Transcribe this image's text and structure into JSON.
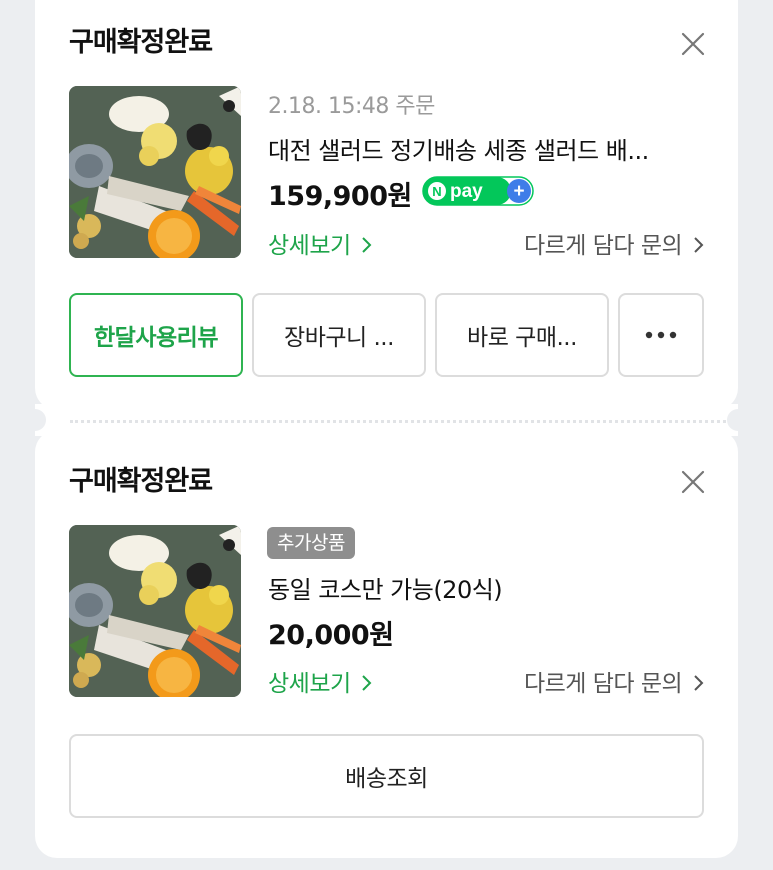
{
  "orders": [
    {
      "status": "구매확정완료",
      "date": "2.18. 15:48 주문",
      "product_name": "대전 샐러드 정기배송 세종 샐러드 배...",
      "price": "159,900원",
      "detail_link": "상세보기",
      "inquiry_link": "다르게 담다 문의",
      "actions": [
        "한달사용리뷰",
        "장바구니 ...",
        "바로 구매...",
        "•••"
      ]
    },
    {
      "status": "구매확정완료",
      "badge": "추가상품",
      "product_name": "동일 코스만 가능(20식)",
      "price": "20,000원",
      "detail_link": "상세보기",
      "inquiry_link": "다르게 담다 문의",
      "delivery_button": "배송조회"
    }
  ],
  "npay_logo": {
    "text": "pay",
    "n": "N",
    "plus": "+"
  },
  "colors": {
    "accent_green": "#1ea44a",
    "npay_green": "#03c75a",
    "npay_blue": "#3f7de8",
    "badge_gray": "#8e8e8e"
  },
  "icons": {
    "close": "close-icon",
    "chevron": "chevron-right-icon",
    "more": "more-horizontal-icon"
  }
}
